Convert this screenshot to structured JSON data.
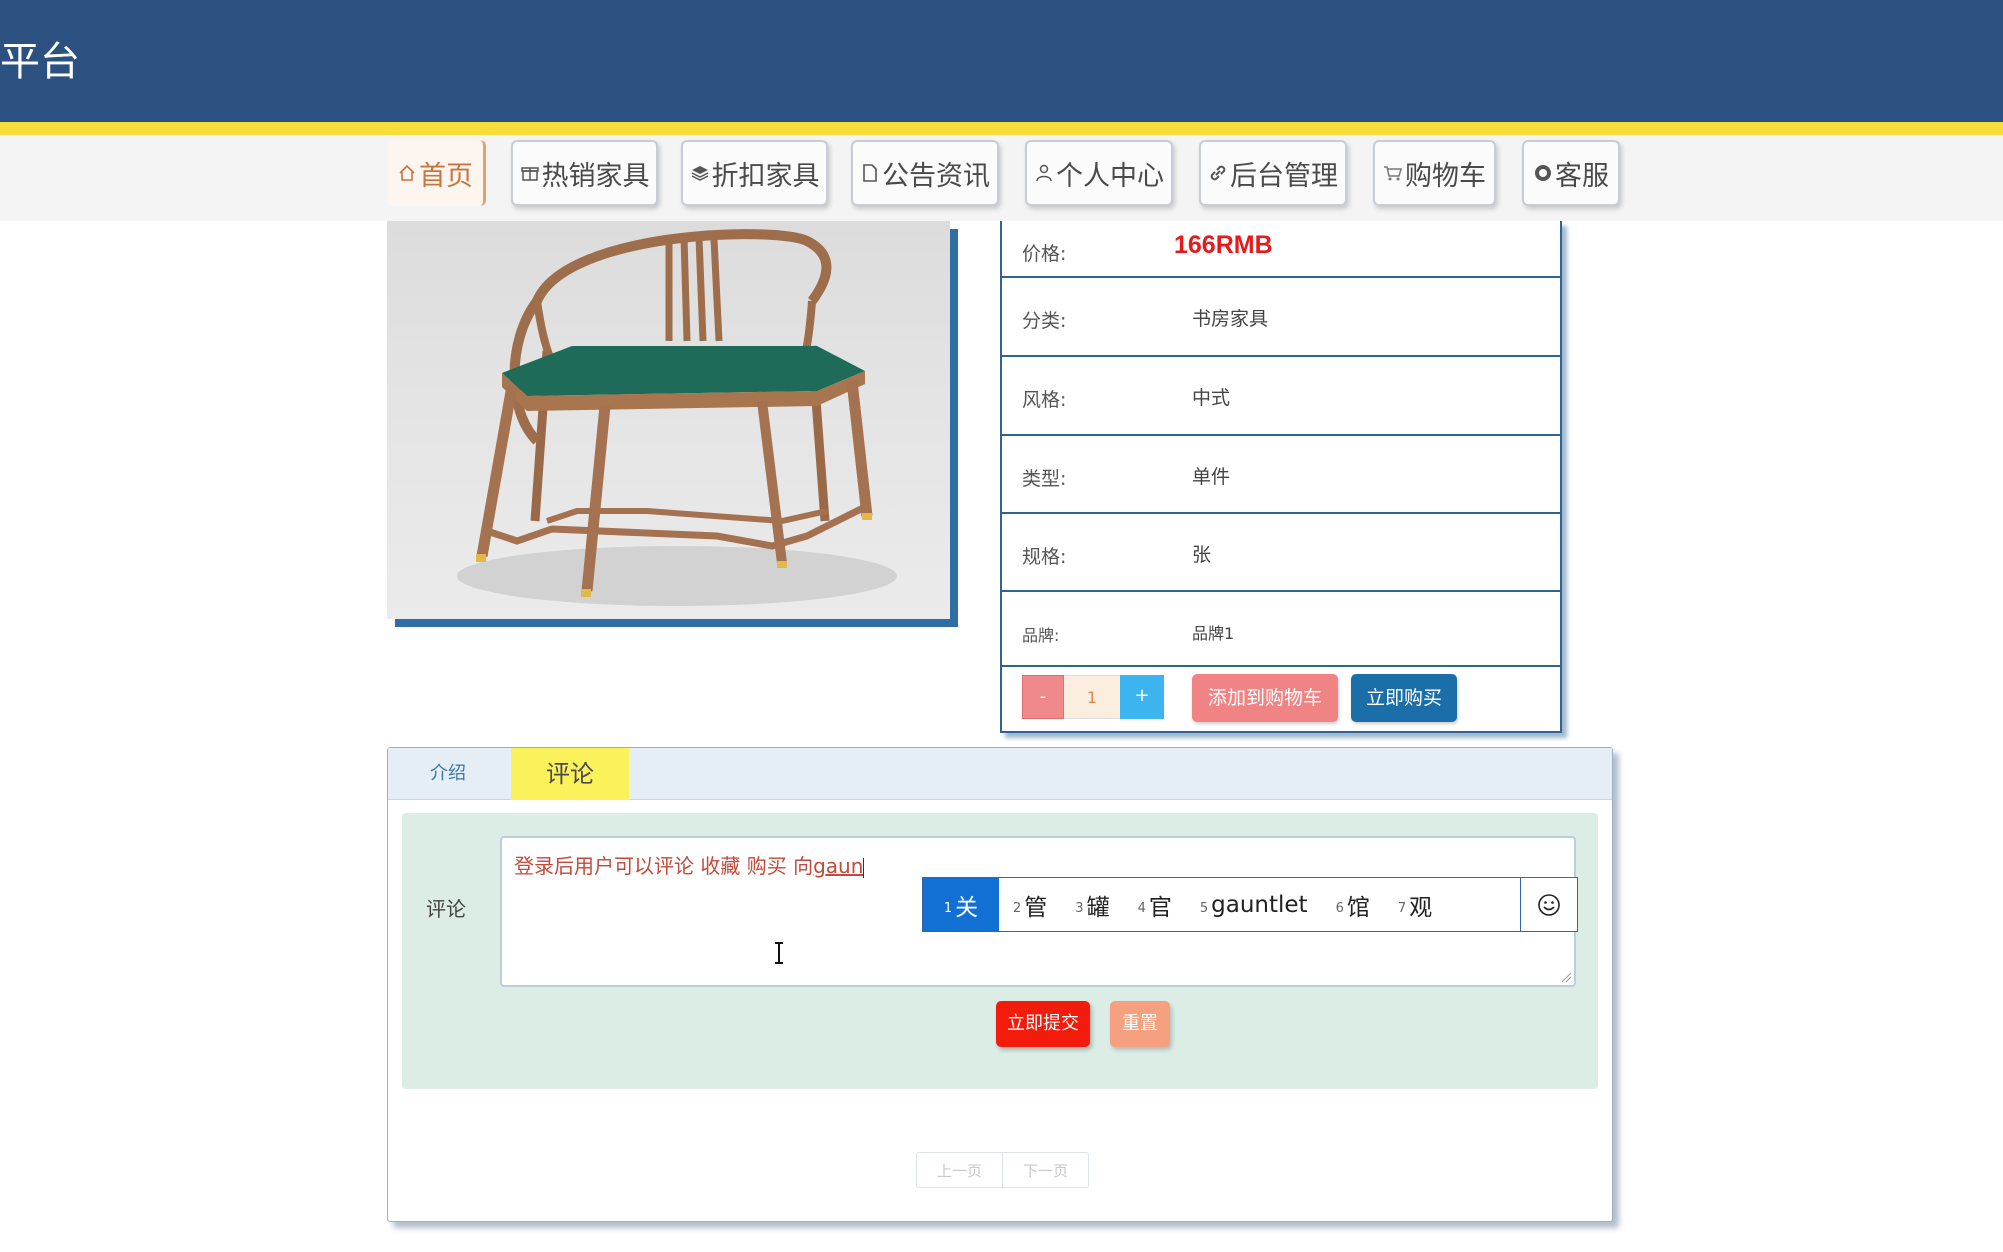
{
  "header": {
    "site_title": "平台"
  },
  "nav": [
    {
      "label": "首页",
      "icon": "home-icon",
      "active": true
    },
    {
      "label": "热销家具",
      "icon": "gift-icon"
    },
    {
      "label": "折扣家具",
      "icon": "layers-icon"
    },
    {
      "label": "公告资讯",
      "icon": "document-icon"
    },
    {
      "label": "个人中心",
      "icon": "user-icon"
    },
    {
      "label": "后台管理",
      "icon": "link-icon"
    },
    {
      "label": "购物车",
      "icon": "cart-icon"
    },
    {
      "label": "客服",
      "icon": "support-icon"
    }
  ],
  "product": {
    "image_icon": "armchair-image",
    "specs": [
      {
        "label": "价格:",
        "value": "166RMB"
      },
      {
        "label": "分类:",
        "value": "书房家具"
      },
      {
        "label": "风格:",
        "value": "中式"
      },
      {
        "label": "类型:",
        "value": "单件"
      },
      {
        "label": "规格:",
        "value": "张"
      },
      {
        "label": "品牌:",
        "value": "品牌1"
      }
    ],
    "quantity": {
      "minus": "-",
      "value": "1",
      "plus": "+"
    },
    "add_to_cart": "添加到购物车",
    "buy_now": "立即购买"
  },
  "tabs": [
    {
      "label": "介绍",
      "active": false
    },
    {
      "label": "评论",
      "active": true
    }
  ],
  "comment_form": {
    "label": "评论",
    "text_before": "登录后用户可以评论  收藏  购买  向",
    "composing": "gaun",
    "ime_candidates": [
      {
        "num": "1",
        "text": "关"
      },
      {
        "num": "2",
        "text": "管"
      },
      {
        "num": "3",
        "text": "罐"
      },
      {
        "num": "4",
        "text": "官"
      },
      {
        "num": "5",
        "text": "gauntlet"
      },
      {
        "num": "6",
        "text": "馆"
      },
      {
        "num": "7",
        "text": "观"
      }
    ],
    "submit": "立即提交",
    "reset": "重置"
  },
  "pagination": {
    "prev": "上一页",
    "next": "下一页"
  },
  "colors": {
    "header_bg": "#2c5180",
    "accent_yellow": "#f8de3a",
    "price_red": "#e51b1b",
    "buy_blue": "#1b6ea8",
    "ime_selected": "#1270d4"
  }
}
